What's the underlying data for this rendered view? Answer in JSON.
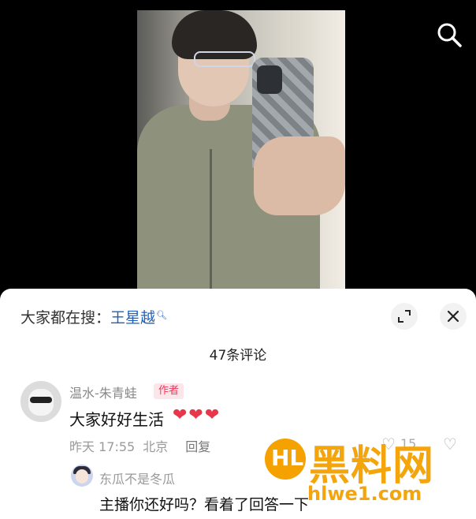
{
  "hot_search": {
    "prefix": "大家都在搜：",
    "term": "王星越"
  },
  "comments_header": {
    "count_label": "47条评论"
  },
  "comments": [
    {
      "author": "温水-朱青蛙",
      "badge": "作者",
      "text": "大家好好生活",
      "emoji": "❤❤❤",
      "time": "昨天 17:55",
      "location": "北京",
      "reply_label": "回复",
      "like_count": "15"
    }
  ],
  "replies": [
    {
      "author": "东瓜不是冬瓜",
      "text": "主播你还好吗？看着了回答一下"
    }
  ],
  "watermark": {
    "title": "黑料网",
    "url": "hlwe1.com",
    "logo_text": "HL"
  },
  "colors": {
    "accent_link": "#1f5fbf",
    "badge": "#f2355b",
    "watermark": "#f5a100"
  },
  "icons": {
    "search": "search-icon",
    "expand": "expand-icon",
    "close": "close-icon",
    "like": "heart-outline-icon",
    "dislike": "thumbs-down-icon"
  }
}
